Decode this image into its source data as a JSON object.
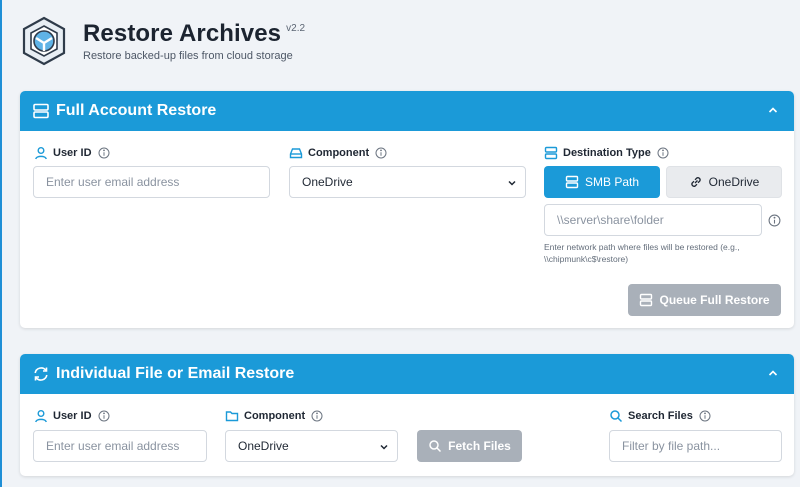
{
  "header": {
    "title": "Restore Archives",
    "version": "v2.2",
    "subtitle": "Restore backed-up files from cloud storage"
  },
  "full_restore": {
    "title": "Full Account Restore",
    "user_id_label": "User ID",
    "user_id_placeholder": "Enter user email address",
    "component_label": "Component",
    "component_value": "OneDrive",
    "destination_label": "Destination Type",
    "smb_button": "SMB Path",
    "onedrive_button": "OneDrive",
    "path_placeholder": "\\\\server\\share\\folder",
    "path_hint": "Enter network path where files will be restored (e.g., \\\\chipmunk\\c$\\restore)",
    "queue_button": "Queue Full Restore"
  },
  "individual_restore": {
    "title": "Individual File or Email Restore",
    "user_id_label": "User ID",
    "user_id_placeholder": "Enter user email address",
    "component_label": "Component",
    "component_value": "OneDrive",
    "fetch_button": "Fetch Files",
    "search_label": "Search Files",
    "search_placeholder": "Filter by file path..."
  },
  "colors": {
    "accent": "#1b9ad8",
    "background": "#f0f3f7",
    "disabled_button": "#a9b0b9"
  },
  "icons": [
    "archive-logo-icon",
    "server-icon",
    "user-icon",
    "info-icon",
    "drive-icon",
    "chevron-up-icon",
    "chevron-down-icon",
    "link-icon",
    "refresh-icon",
    "folder-icon",
    "search-icon"
  ]
}
